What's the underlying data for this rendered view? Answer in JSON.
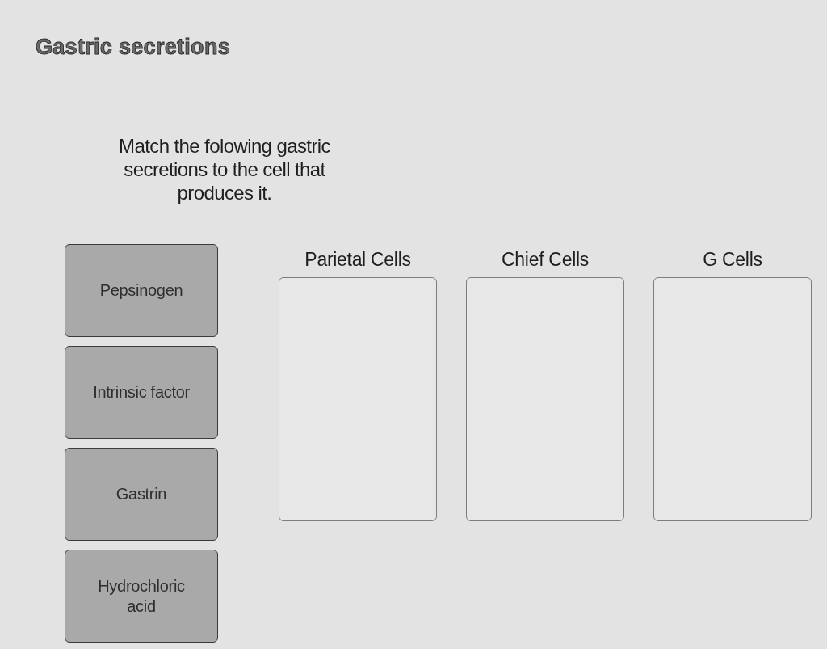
{
  "title": "Gastric secretions",
  "instructions": "Match the folowing gastric secretions to the cell that produces it.",
  "items": [
    {
      "label": "Pepsinogen"
    },
    {
      "label": "Intrinsic factor"
    },
    {
      "label": "Gastrin"
    },
    {
      "label": "Hydrochloric acid"
    }
  ],
  "targets": [
    {
      "heading": "Parietal Cells"
    },
    {
      "heading": "Chief Cells"
    },
    {
      "heading": "G Cells"
    }
  ]
}
